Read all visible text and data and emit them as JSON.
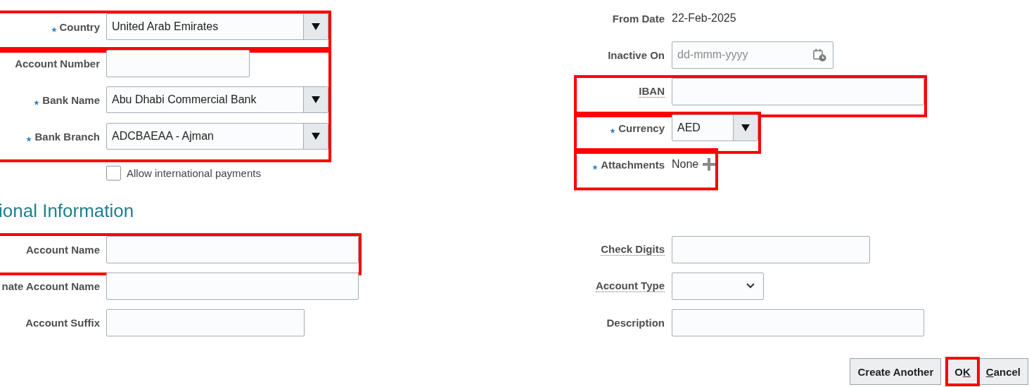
{
  "left_top": [
    {
      "highlighted": true,
      "fields": [
        {
          "kind": "select",
          "label": "Country",
          "required": true,
          "value": "United Arab Emirates"
        }
      ]
    },
    {
      "highlighted": true,
      "fields": [
        {
          "kind": "text",
          "label": "Account Number",
          "required": false
        },
        {
          "kind": "select",
          "label": "Bank Name",
          "required": true,
          "value": "Abu Dhabi Commercial Bank"
        },
        {
          "kind": "select",
          "label": "Bank Branch",
          "required": true,
          "value": "ADCBAEAA - Ajman"
        }
      ]
    },
    {
      "highlighted": false,
      "fields": [
        {
          "kind": "checkbox",
          "label": "Allow international payments",
          "checked": false
        }
      ]
    }
  ],
  "right_top": [
    {
      "highlighted": false,
      "fields": [
        {
          "kind": "readonly",
          "label": "From Date",
          "value": "22-Feb-2025"
        },
        {
          "kind": "date",
          "label": "Inactive On",
          "placeholder": "dd-mmm-yyyy"
        }
      ]
    },
    {
      "highlighted": true,
      "fields": [
        {
          "kind": "text",
          "label": "IBAN",
          "help": true
        }
      ]
    },
    {
      "highlighted": true,
      "fields": [
        {
          "kind": "select",
          "label": "Currency",
          "required": true,
          "value": "AED"
        }
      ]
    },
    {
      "highlighted": true,
      "fields": [
        {
          "kind": "attachments",
          "label": "Attachments",
          "required": true,
          "value": "None"
        }
      ]
    }
  ],
  "section_heading": "ional Information",
  "left_bottom": [
    {
      "highlighted": true,
      "fields": [
        {
          "kind": "text",
          "label": "Account Name"
        }
      ]
    },
    {
      "highlighted": false,
      "fields": [
        {
          "kind": "text",
          "label": "nate Account Name"
        },
        {
          "kind": "text",
          "label": "Account Suffix"
        }
      ]
    }
  ],
  "right_bottom": [
    {
      "highlighted": false,
      "fields": [
        {
          "kind": "text",
          "label": "Check Digits",
          "help": true
        },
        {
          "kind": "dropdown",
          "label": "Account Type",
          "help": true
        },
        {
          "kind": "text",
          "label": "Description"
        }
      ]
    }
  ],
  "buttons": [
    {
      "label": "Create Another",
      "highlighted": false
    },
    {
      "before": "O",
      "key": "K",
      "highlighted": true
    },
    {
      "key": "C",
      "after": "ancel",
      "highlighted": false
    }
  ]
}
